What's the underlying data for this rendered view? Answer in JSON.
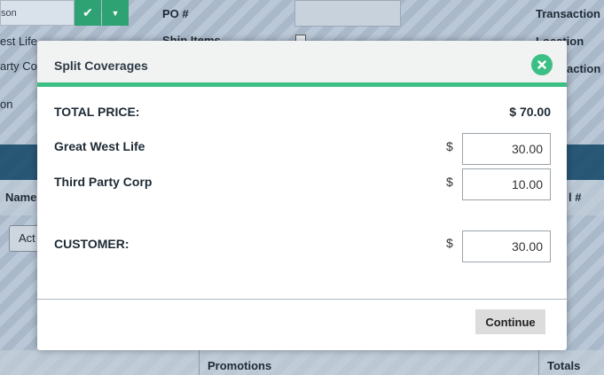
{
  "background": {
    "combo_text": "son",
    "po_label": "PO #",
    "ship_items_label": "Ship Items",
    "transaction_label": "Transaction",
    "location_label": "Location",
    "transaction2_label": "action",
    "west_life": "est Life",
    "party_co": "arty Co",
    "on_label": "on",
    "name_col": "Name",
    "last_col": "l #",
    "act_label": "Act",
    "promotions_col": "Promotions",
    "totals_col": "Totals"
  },
  "modal": {
    "title": "Split Coverages",
    "total_label": "TOTAL PRICE:",
    "total_value": "$ 70.00",
    "currency_symbol": "$",
    "coverages": [
      {
        "label": "Great West Life",
        "amount": "30.00"
      },
      {
        "label": "Third Party Corp",
        "amount": "10.00"
      }
    ],
    "customer_label": "CUSTOMER:",
    "customer_amount": "30.00",
    "continue_label": "Continue"
  }
}
